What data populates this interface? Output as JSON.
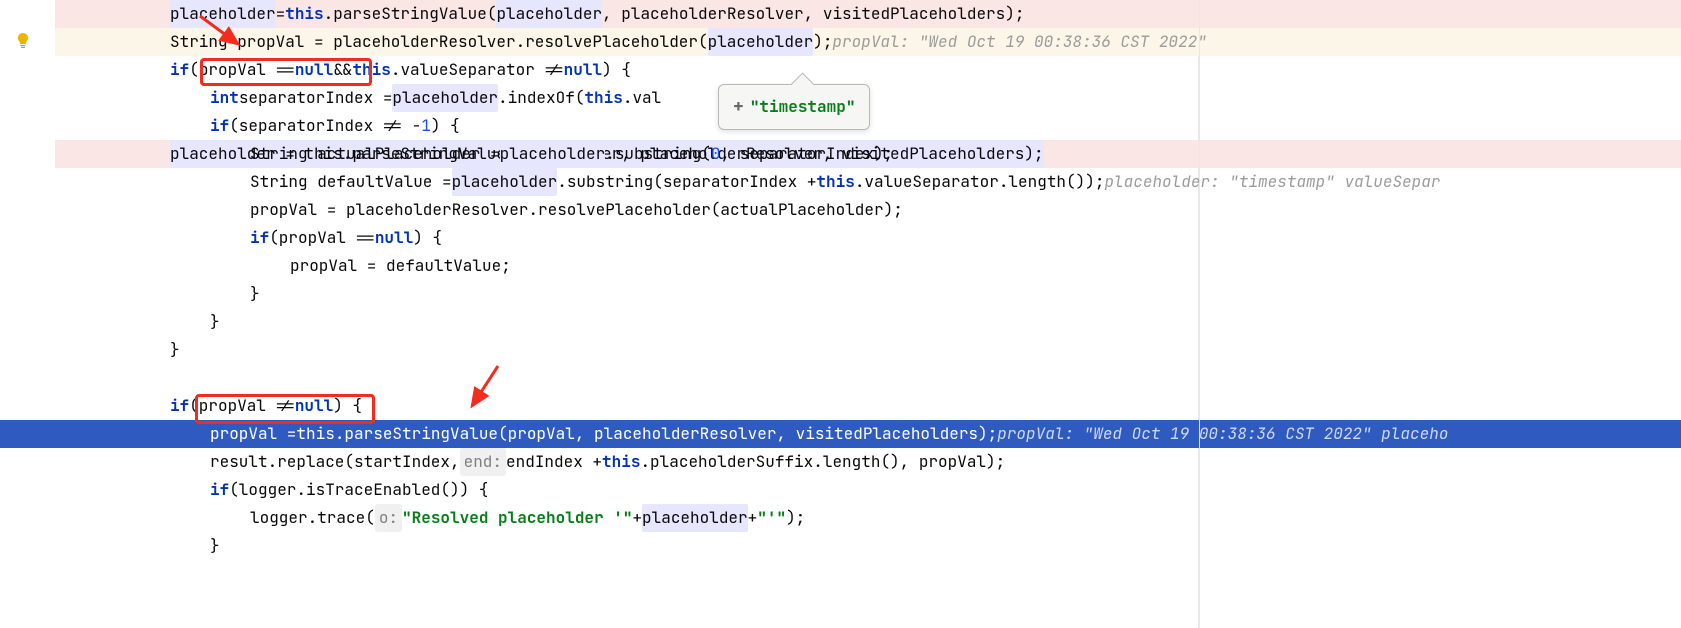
{
  "tooltip": {
    "plus": "+",
    "text": "\"timestamp\""
  },
  "lines": {
    "l1": "placeholder = this.parseStringValue(placeholder, placeholderResolver, visitedPlaceholders);",
    "l2a": "String propVal = placeholderResolver.resolvePlaceholder(",
    "l2b": "placeholder",
    "l2c": ");",
    "l2hint": "propVal: \"Wed Oct 19 00:38:36 CST 2022\"",
    "l3a": "if (",
    "l3box": "propVal == null",
    "l3b": " && this.valueSeparator != null) {",
    "l4a": "int separatorIndex = ",
    "l4b": "placeholder",
    "l4c": ".indexOf(this.val",
    "l5": "if (separatorIndex != -1) {",
    "l6a": "String actualPlaceholder = ",
    "l6b": "placeholder",
    "l6c": ".substring(0, separatorIndex);",
    "l7a": "String defaultValue = ",
    "l7b": "placeholder",
    "l7c": ".substring(separatorIndex + this.valueSeparator.length());",
    "l7hint": "placeholder: \"timestamp\"   valueSepar",
    "l8": "propVal = placeholderResolver.resolvePlaceholder(actualPlaceholder);",
    "l9a": "if (propVal == ",
    "l9b": "null",
    "l9c": ") {",
    "l10": "propVal = defaultValue;",
    "l11": "}",
    "l12": "}",
    "l13": "}",
    "l14": "",
    "l15a": "if (",
    "l15box": "propVal != null)",
    "l15b": " {",
    "l16a": "propVal = this.parseStringValue(propVal, placeholderResolver, visitedPlaceholders);",
    "l16hint": "propVal: \"Wed Oct 19 00:38:36 CST 2022\"   placeho",
    "l17a": "result.replace(startIndex, ",
    "l17param": "end:",
    "l17b": " endIndex + this.placeholderSuffix.length(), propVal);",
    "l18": "if (logger.isTraceEnabled()) {",
    "l19a": "logger.trace(",
    "l19param": "o:",
    "l19b": "\"Resolved placeholder '\"",
    "l19c": " + ",
    "l19d": "placeholder",
    "l19e": " + ",
    "l19f": "\"'\"",
    "l19g": ");",
    "l20": "}"
  }
}
